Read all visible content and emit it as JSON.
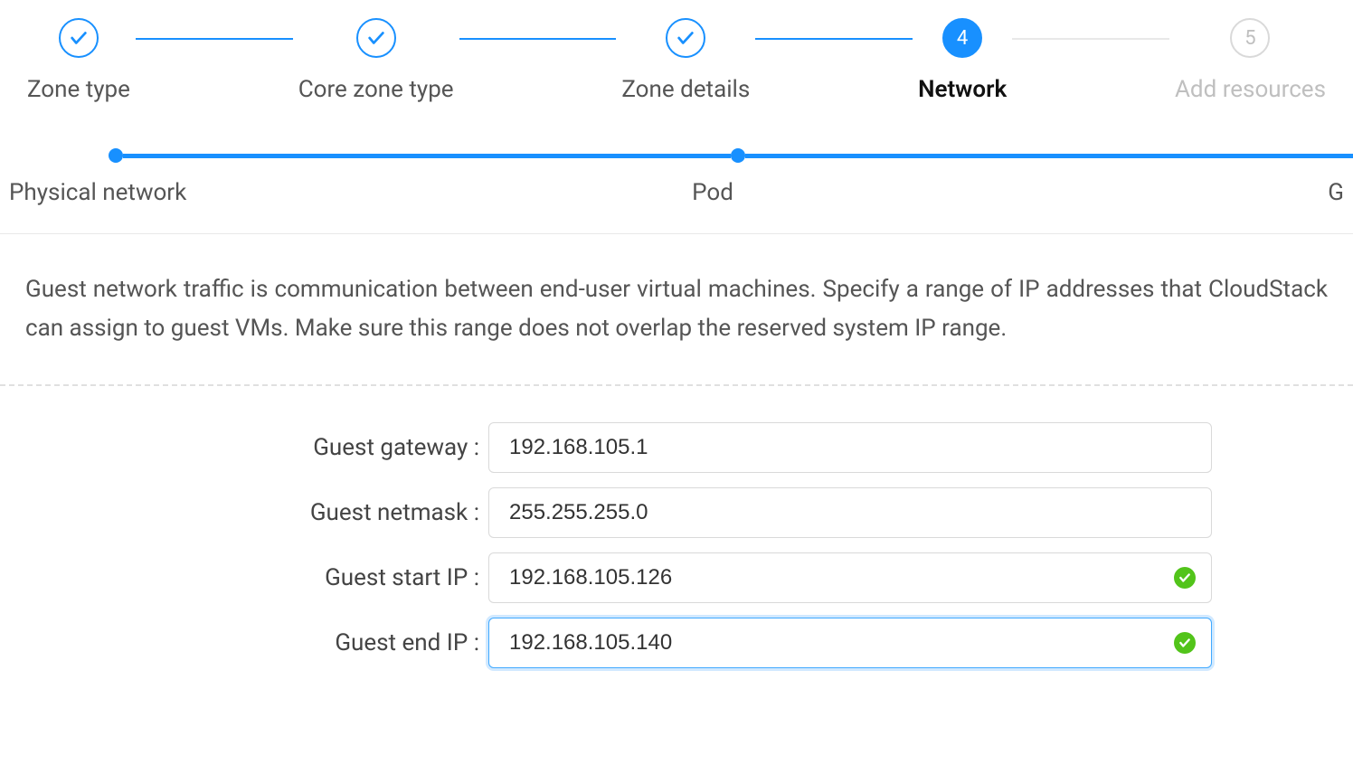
{
  "colors": {
    "primary": "#1890ff",
    "success": "#52c41a"
  },
  "mainSteps": [
    {
      "label": "Zone type",
      "state": "done"
    },
    {
      "label": "Core zone type",
      "state": "done"
    },
    {
      "label": "Zone details",
      "state": "done"
    },
    {
      "label": "Network",
      "state": "active",
      "number": "4"
    },
    {
      "label": "Add resources",
      "state": "pending",
      "number": "5"
    }
  ],
  "subSteps": {
    "left": "Physical network",
    "center": "Pod",
    "right": "G"
  },
  "description": "Guest network traffic is communication between end-user virtual machines. Specify a range of IP addresses that CloudStack can assign to guest VMs. Make sure this range does not overlap the reserved system IP range.",
  "form": {
    "guestGateway": {
      "label": "Guest gateway :",
      "value": "192.168.105.1"
    },
    "guestNetmask": {
      "label": "Guest netmask :",
      "value": "255.255.255.0"
    },
    "guestStartIp": {
      "label": "Guest start IP :",
      "value": "192.168.105.126",
      "valid": true
    },
    "guestEndIp": {
      "label": "Guest end IP :",
      "value": "192.168.105.140",
      "valid": true,
      "focused": true
    }
  }
}
